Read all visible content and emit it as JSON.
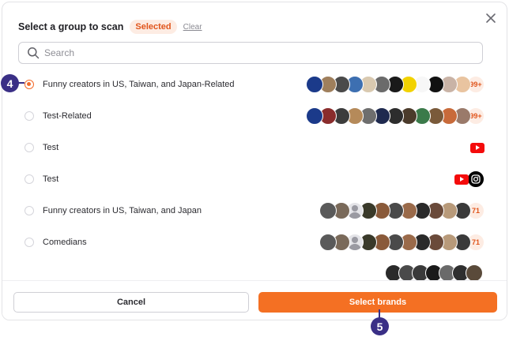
{
  "header": {
    "title": "Select a group to scan",
    "selected_tab": "Selected",
    "clear_link": "Clear"
  },
  "search": {
    "placeholder": "Search",
    "value": ""
  },
  "groups": [
    {
      "label": "Funny creators in US, Taiwan, and Japan-Related",
      "checked": true,
      "count": "99+",
      "avatars": [
        "#1b3a8a",
        "#9f7f5c",
        "#4a4a4a",
        "#3d6fb1",
        "#d9c9b0",
        "#6b6b6b",
        "#1a1a1a",
        "#f2d200",
        "#f7f7f7",
        "#111111",
        "#c9b3a6",
        "#e9c4a0"
      ]
    },
    {
      "label": "Test-Related",
      "checked": false,
      "count": "99+",
      "avatars": [
        "#1b3a8a",
        "#8a2c2c",
        "#3c3c3c",
        "#b58a5a",
        "#6e6e6e",
        "#1f2a4f",
        "#2d2d2d",
        "#4b3b2b",
        "#3b7a4a",
        "#7a5a3a",
        "#c86a3a",
        "#9a7a6a"
      ]
    },
    {
      "label": "Test",
      "checked": false,
      "platforms": [
        "youtube"
      ]
    },
    {
      "label": "Test",
      "checked": false,
      "platforms": [
        "youtube",
        "instagram"
      ]
    },
    {
      "label": "Funny creators in US, Taiwan, and Japan",
      "checked": false,
      "count": "71",
      "avatars": [
        "#5a5a5a",
        "#7a6a5a",
        "person",
        "#3a3a2a",
        "#8a5a3a",
        "#4a4a4a",
        "#9a6a4a",
        "#2a2a2a",
        "#6a4a3a",
        "#b89a7a",
        "#3a3a3a"
      ]
    },
    {
      "label": "Comedians",
      "checked": false,
      "count": "71",
      "avatars": [
        "#5a5a5a",
        "#7a6a5a",
        "person",
        "#3a3a2a",
        "#8a5a3a",
        "#4a4a4a",
        "#9a6a4a",
        "#2a2a2a",
        "#6a4a3a",
        "#b89a7a",
        "#3a3a3a"
      ]
    }
  ],
  "partial_row_avatars": [
    "#2a2a2a",
    "#4a4a4a",
    "#3a3a3a",
    "#1a1a1a",
    "#6a6a6a",
    "#2f2f2f",
    "#5a4a3a"
  ],
  "footer": {
    "cancel_label": "Cancel",
    "select_label": "Select brands"
  },
  "annotations": {
    "step_a": "4",
    "step_b": "5"
  },
  "colors": {
    "accent": "#f47023",
    "accent_soft": "#fdece3",
    "marker": "#3a2f86"
  }
}
